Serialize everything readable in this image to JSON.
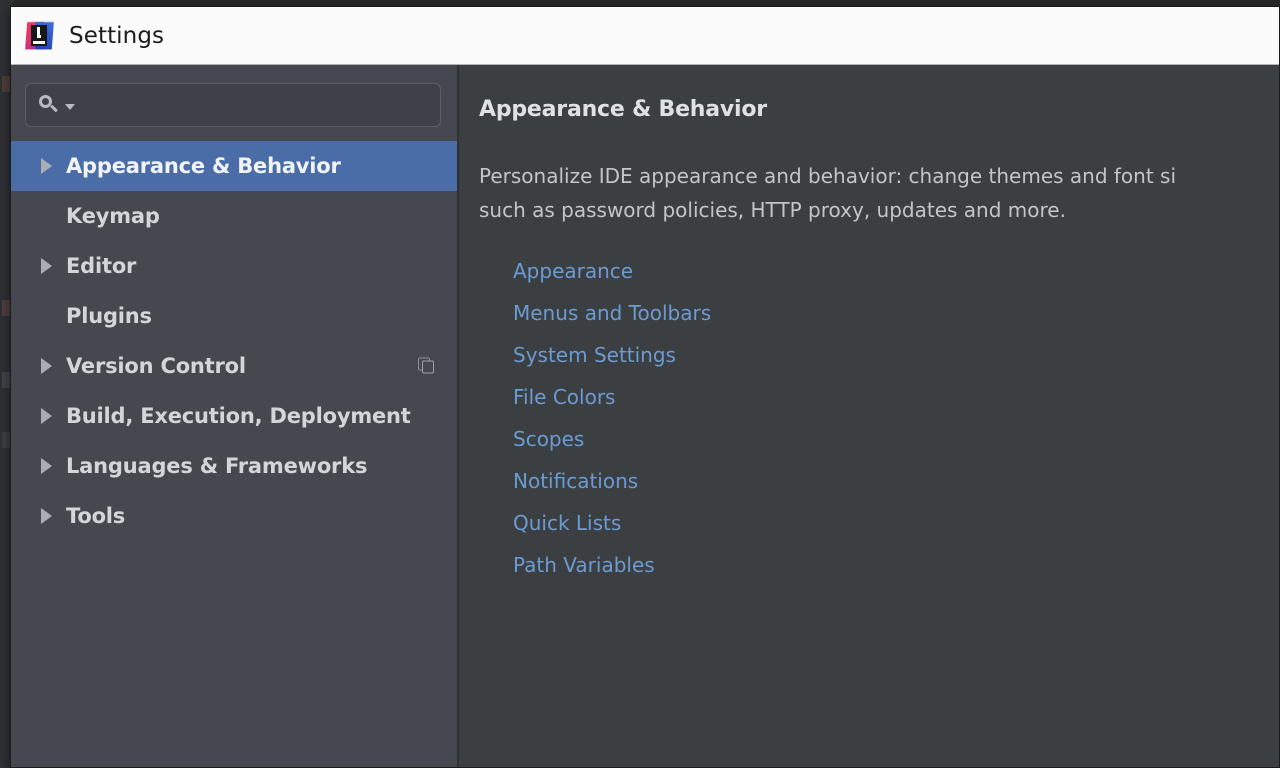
{
  "window": {
    "title": "Settings",
    "logo_icon": "intellij-idea-logo-icon"
  },
  "search": {
    "value": "",
    "placeholder": "",
    "icon": "search-icon",
    "dropdown_icon": "chevron-down-icon"
  },
  "sidebar": {
    "items": [
      {
        "label": "Appearance & Behavior",
        "expandable": true,
        "selected": true,
        "badge_icon": ""
      },
      {
        "label": "Keymap",
        "expandable": false,
        "selected": false,
        "badge_icon": ""
      },
      {
        "label": "Editor",
        "expandable": true,
        "selected": false,
        "badge_icon": ""
      },
      {
        "label": "Plugins",
        "expandable": false,
        "selected": false,
        "badge_icon": ""
      },
      {
        "label": "Version Control",
        "expandable": true,
        "selected": false,
        "badge_icon": "copy-icon"
      },
      {
        "label": "Build, Execution, Deployment",
        "expandable": true,
        "selected": false,
        "badge_icon": ""
      },
      {
        "label": "Languages & Frameworks",
        "expandable": true,
        "selected": false,
        "badge_icon": ""
      },
      {
        "label": "Tools",
        "expandable": true,
        "selected": false,
        "badge_icon": ""
      }
    ]
  },
  "detail": {
    "title": "Appearance & Behavior",
    "description_line_1": "Personalize IDE appearance and behavior: change themes and font si",
    "description_line_2": "such as password policies, HTTP proxy, updates and more.",
    "links": [
      "Appearance",
      "Menus and Toolbars",
      "System Settings",
      "File Colors",
      "Scopes",
      "Notifications",
      "Quick Lists",
      "Path Variables"
    ]
  },
  "colors": {
    "selection_blue": "#4a6da7",
    "link_blue": "#6b9bd2",
    "sidebar_bg": "#45484f",
    "detail_bg": "#3c3f41",
    "titlebar_bg": "#fbfbfb"
  }
}
